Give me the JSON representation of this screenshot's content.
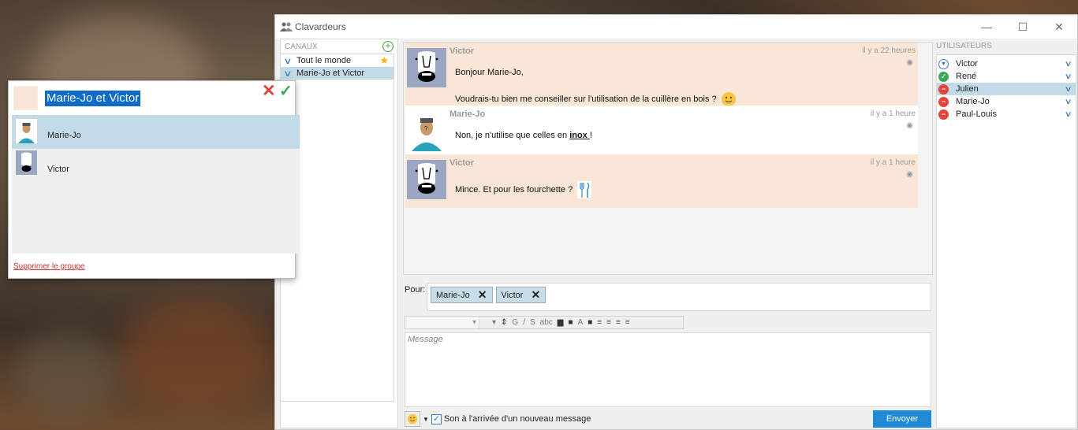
{
  "window": {
    "title": "Clavardeurs",
    "controls": [
      "—",
      "☐",
      "✕"
    ]
  },
  "channels": {
    "header": "CANAUX",
    "items": [
      {
        "label": "Tout le monde",
        "favorite": true
      },
      {
        "label": "Marie-Jo et Victor",
        "selected": true
      }
    ]
  },
  "messages": [
    {
      "author": "Victor",
      "time": "il y a 22 heures",
      "line1": "Bonjour Marie-Jo,",
      "line2": "Voudrais-tu bien me conseiller sur l'utilisation de la cuillère en bois ?",
      "emoji": "smiley-icon"
    },
    {
      "author": "Marie-Jo",
      "time": "il y a 1 heure",
      "text_before": "Non, je n'utilise que celles en ",
      "text_bold": "inox ",
      "text_after": "!"
    },
    {
      "author": "Victor",
      "time": "il y a 1 heure",
      "text": "Mince. Et pour les fourchette ?",
      "emoji": "cutlery-icon"
    }
  ],
  "recipients": {
    "label": "Pour:",
    "chips": [
      "Marie-Jo",
      "Victor"
    ]
  },
  "toolbar": {
    "tools": [
      "G",
      "/",
      "S",
      "abc",
      "A"
    ]
  },
  "composer": {
    "placeholder": "Message",
    "sound_label": "Son à l'arrivée d'un nouveau message",
    "send_label": "Envoyer"
  },
  "users": {
    "header": "UTILISATEURS",
    "items": [
      {
        "name": "Victor",
        "status": "available"
      },
      {
        "name": "René",
        "status": "online"
      },
      {
        "name": "Julien",
        "status": "busy",
        "selected": true
      },
      {
        "name": "Marie-Jo",
        "status": "busy"
      },
      {
        "name": "Paul-Louis",
        "status": "busy"
      }
    ]
  },
  "group_editor": {
    "group_name": "Marie-Jo et Victor",
    "members": [
      "Marie-Jo",
      "Victor"
    ],
    "delete_label": "Supprimer le groupe"
  },
  "colors": {
    "victor_bg": "#fae6d6",
    "selection": "#c3dbe6",
    "accent": "#1f8ad8"
  }
}
